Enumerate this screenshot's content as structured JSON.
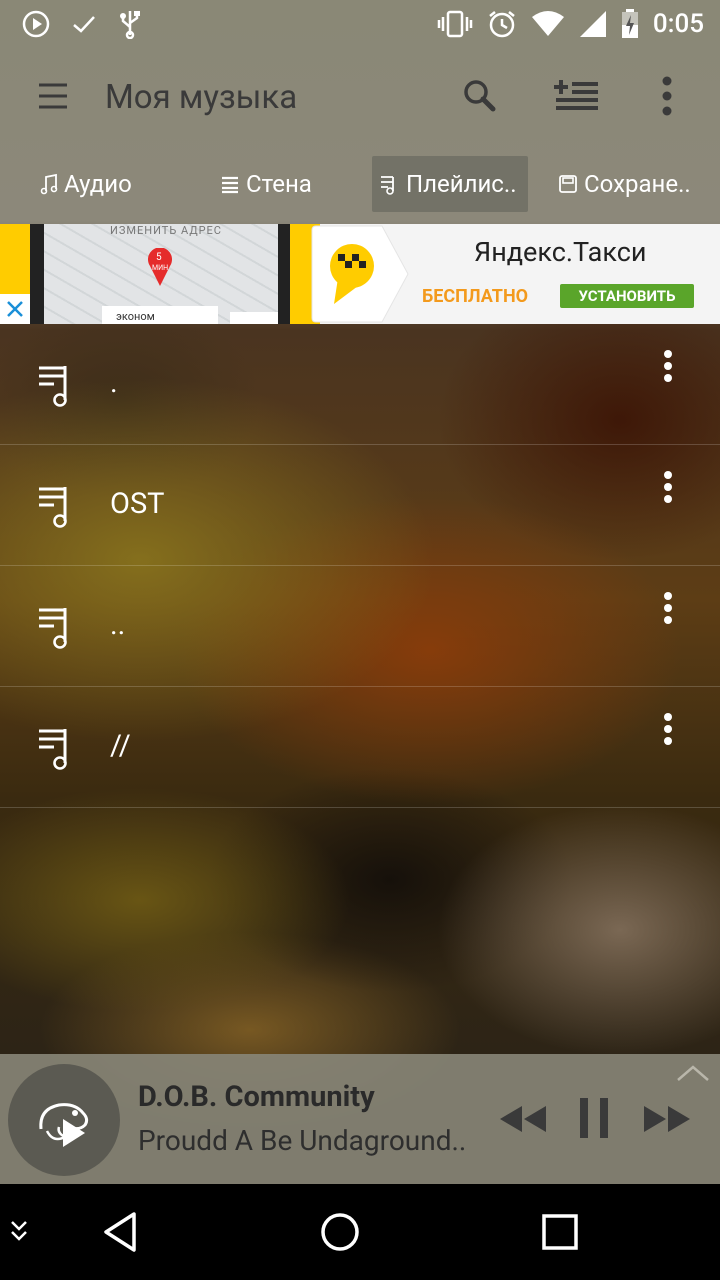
{
  "status_bar": {
    "time": "0:05",
    "icons": [
      "play-circle-icon",
      "check-icon",
      "usb-icon",
      "vibrate-icon",
      "alarm-icon",
      "wifi-icon",
      "signal-icon",
      "battery-icon"
    ]
  },
  "app_bar": {
    "title": "Моя музыка",
    "icons": [
      "menu-icon",
      "search-icon",
      "add-playlist-icon",
      "more-vert-icon"
    ]
  },
  "tabs": [
    {
      "label": "Аудио",
      "icon": "music-note-icon",
      "active": false
    },
    {
      "label": "Стена",
      "icon": "wall-icon",
      "active": false
    },
    {
      "label": "Плейлис..",
      "icon": "playlist-icon",
      "active": true
    },
    {
      "label": "Сохране..",
      "icon": "save-icon",
      "active": false
    }
  ],
  "ad": {
    "map_label": "ИЗМЕНИТЬ АДРЕС",
    "map_marker": "5",
    "map_marker_unit": "МИН",
    "map_card": "эконом",
    "title": "Яндекс.Такси",
    "price": "БЕСПЛАТНО",
    "install": "УСТАНОВИТЬ",
    "colors": {
      "yellow": "#ffcc00",
      "green": "#5aa52a",
      "orange": "#f39a1d"
    }
  },
  "playlists": [
    {
      "title": "."
    },
    {
      "title": "OST"
    },
    {
      "title": ".."
    },
    {
      "title": "//"
    }
  ],
  "player": {
    "artist": "D.O.B. Community",
    "track": "Proudd A Be Undaground..",
    "state": "playing"
  },
  "nav_bar": {
    "icons": [
      "chevron-double-down-icon",
      "back-icon",
      "home-icon",
      "recents-icon"
    ]
  }
}
